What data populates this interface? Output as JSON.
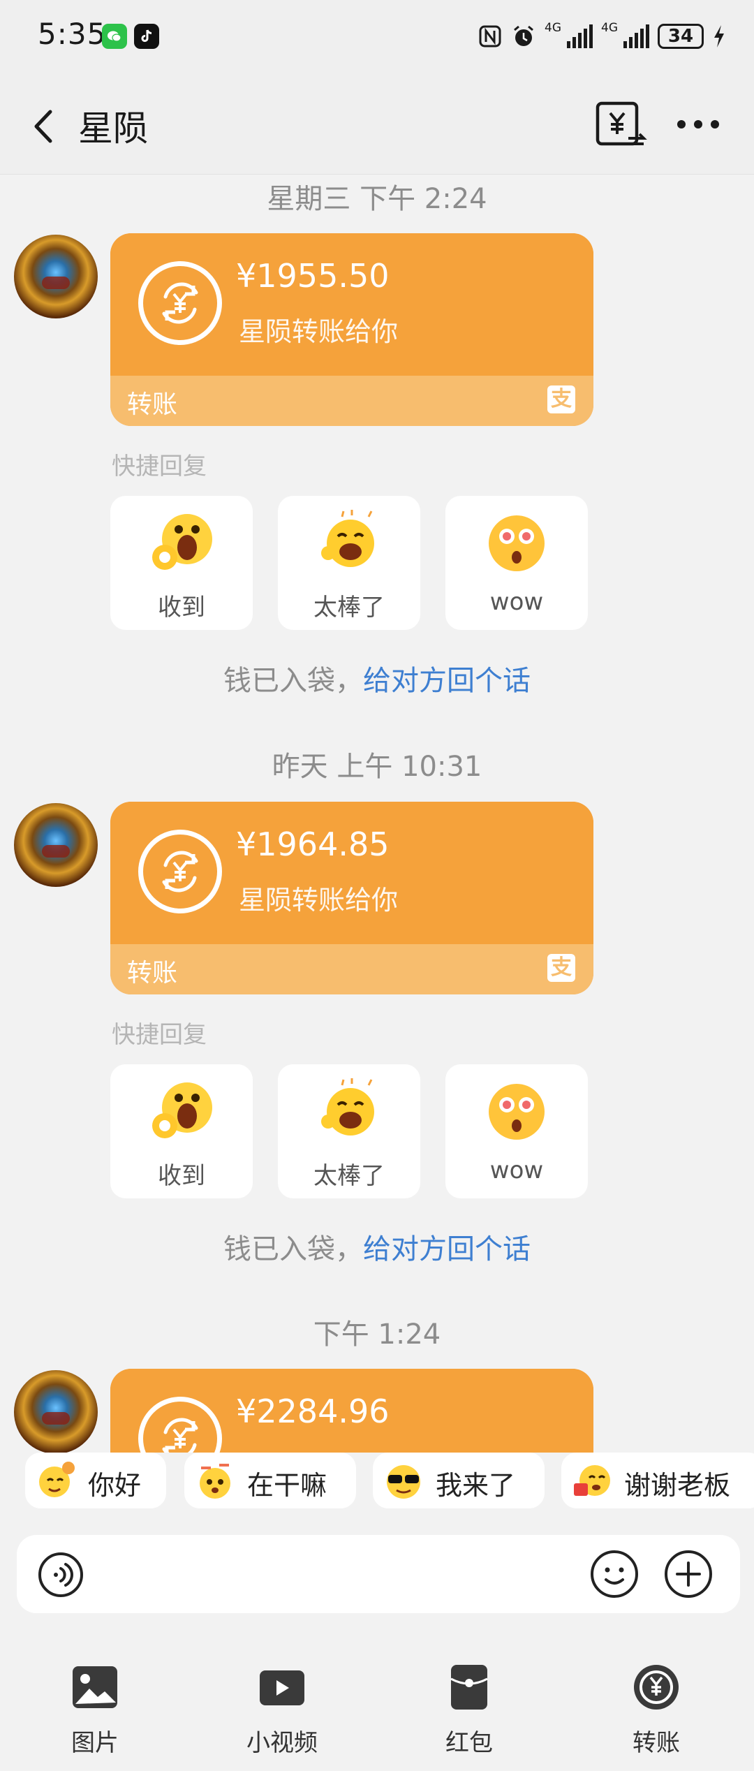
{
  "status_bar": {
    "time": "5:35",
    "signal_label_1": "4G",
    "signal_label_2": "4G",
    "battery": "34"
  },
  "header": {
    "title": "星陨"
  },
  "messages": [
    {
      "timestamp": "星期三 下午 2:24",
      "amount": "¥1955.50",
      "desc": "星陨转账给你",
      "label": "转账",
      "quick_title": "快捷回复",
      "quick_replies": [
        "收到",
        "太棒了",
        "wow"
      ],
      "note_prefix": "钱已入袋，",
      "note_link": "给对方回个话"
    },
    {
      "timestamp": "昨天 上午 10:31",
      "amount": "¥1964.85",
      "desc": "星陨转账给你",
      "label": "转账",
      "quick_title": "快捷回复",
      "quick_replies": [
        "收到",
        "太棒了",
        "wow"
      ],
      "note_prefix": "钱已入袋，",
      "note_link": "给对方回个话"
    },
    {
      "timestamp": "下午 1:24",
      "amount": "¥2284.96"
    }
  ],
  "chips": [
    "你好",
    "在干嘛",
    "我来了",
    "谢谢老板"
  ],
  "toolbar": [
    "图片",
    "小视频",
    "红包",
    "转账"
  ],
  "colors": {
    "card": "#f5a23b",
    "card_bottom": "#f7bd6e",
    "link": "#3e7fd1"
  }
}
